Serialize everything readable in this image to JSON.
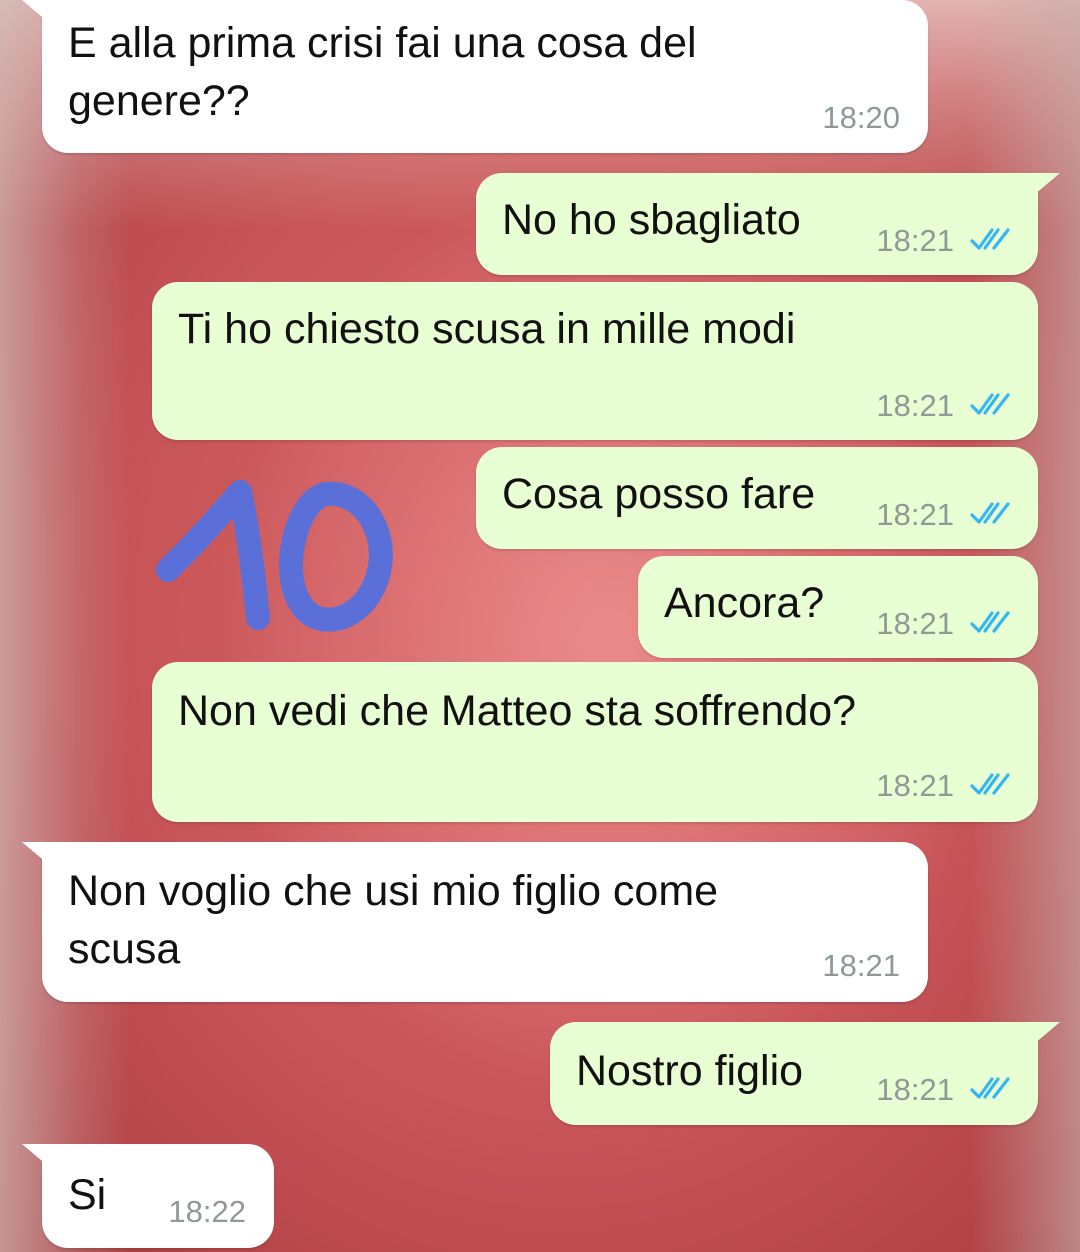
{
  "theme": {
    "incoming_bubble": "#ffffff",
    "outgoing_bubble": "#e8fed3",
    "time_color": "#8f9a95",
    "read_tick_color": "#34b7f1",
    "sticker_color": "#5b6fd8"
  },
  "sticker": {
    "text": "10",
    "icon": "hand-drawn-number-sticker"
  },
  "messages": [
    {
      "direction": "incoming",
      "text_lines": [
        "E alla prima crisi fai una cosa del",
        "genere??"
      ],
      "time": "18:20"
    },
    {
      "direction": "outgoing",
      "text_lines": [
        "No ho sbagliato"
      ],
      "time": "18:21",
      "status": "read",
      "status_icon": "double-check-icon"
    },
    {
      "direction": "outgoing",
      "text_lines": [
        "Ti ho chiesto scusa in mille modi"
      ],
      "time": "18:21",
      "status": "read",
      "status_icon": "double-check-icon"
    },
    {
      "direction": "outgoing",
      "text_lines": [
        "Cosa posso fare"
      ],
      "time": "18:21",
      "status": "read",
      "status_icon": "double-check-icon"
    },
    {
      "direction": "outgoing",
      "text_lines": [
        "Ancora?"
      ],
      "time": "18:21",
      "status": "read",
      "status_icon": "double-check-icon"
    },
    {
      "direction": "outgoing",
      "text_lines": [
        "Non vedi che Matteo sta soffrendo?"
      ],
      "time": "18:21",
      "status": "read",
      "status_icon": "double-check-icon"
    },
    {
      "direction": "incoming",
      "text_lines": [
        "Non voglio che usi mio figlio come",
        "scusa"
      ],
      "time": "18:21"
    },
    {
      "direction": "outgoing",
      "text_lines": [
        "Nostro figlio"
      ],
      "time": "18:21",
      "status": "read",
      "status_icon": "double-check-icon"
    },
    {
      "direction": "incoming",
      "text_lines": [
        "Si"
      ],
      "time": "18:22"
    }
  ]
}
